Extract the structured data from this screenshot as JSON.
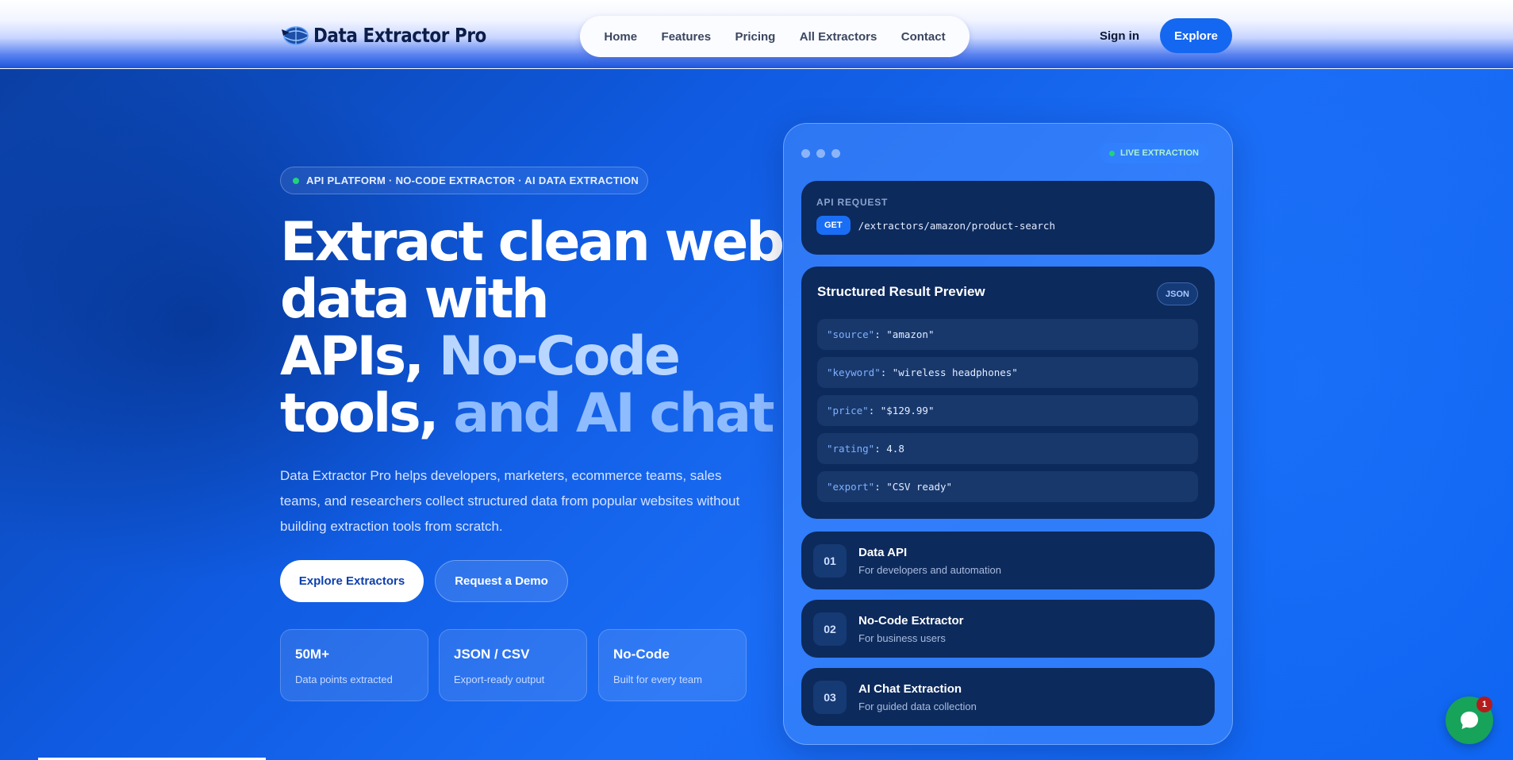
{
  "header": {
    "logo_text": "Data Extractor Pro",
    "nav": [
      "Home",
      "Features",
      "Pricing",
      "All Extractors",
      "Contact"
    ],
    "signin_label": "Sign in",
    "explore_label": "Explore"
  },
  "hero": {
    "badge": "API PLATFORM · NO-CODE EXTRACTOR · AI DATA EXTRACTION",
    "title_line1": "Extract clean web",
    "title_line2": "data with",
    "title_apis": "APIs, ",
    "title_nocode": "No-Code",
    "title_tools": "tools, ",
    "title_and": "and AI chat",
    "description": "Data Extractor Pro helps developers, marketers, ecommerce teams, sales teams, and researchers collect structured data from popular websites without building extraction tools from scratch.",
    "primary_cta": "Explore Extractors",
    "secondary_cta": "Request a Demo",
    "stats": [
      {
        "value": "50M+",
        "label": "Data points extracted"
      },
      {
        "value": "JSON / CSV",
        "label": "Export-ready output"
      },
      {
        "value": "No-Code",
        "label": "Built for every team"
      }
    ]
  },
  "panel": {
    "live_label": "LIVE EXTRACTION",
    "api_label": "API REQUEST",
    "method": "GET",
    "endpoint": "/extractors/amazon/product-search",
    "result_title": "Structured Result Preview",
    "result_badge": "JSON",
    "result_rows": [
      {
        "key": "\"source\"",
        "value": ": \"amazon\""
      },
      {
        "key": "\"keyword\"",
        "value": ": \"wireless headphones\""
      },
      {
        "key": "\"price\"",
        "value": ": \"$129.99\""
      },
      {
        "key": "\"rating\"",
        "value": ": 4.8"
      },
      {
        "key": "\"export\"",
        "value": ": \"CSV ready\""
      }
    ],
    "features": [
      {
        "num": "01",
        "title": "Data API",
        "subtitle": "For developers and automation"
      },
      {
        "num": "02",
        "title": "No-Code Extractor",
        "subtitle": "For business users"
      },
      {
        "num": "03",
        "title": "AI Chat Extraction",
        "subtitle": "For guided data collection"
      }
    ]
  },
  "chat": {
    "unread_count": "1"
  },
  "colors": {
    "accent": "#1467f0",
    "live": "#22d37a",
    "card": "#0d2a5c"
  }
}
